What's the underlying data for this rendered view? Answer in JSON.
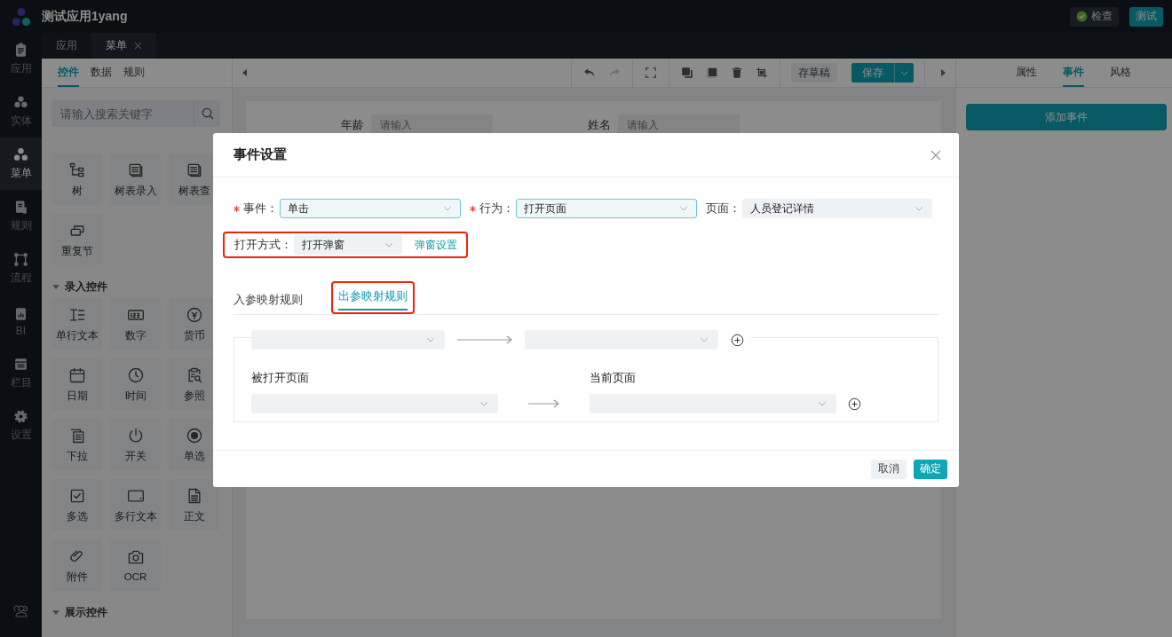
{
  "app": {
    "title": "测试应用1yang",
    "check_button": "检查",
    "test_button": "测试"
  },
  "rail": [
    {
      "label": "应用",
      "kind": "clipboard",
      "selected": false
    },
    {
      "label": "实体",
      "kind": "cubes",
      "selected": false
    },
    {
      "label": "菜单",
      "kind": "dots",
      "selected": true
    },
    {
      "label": "规则",
      "kind": "rules",
      "selected": false
    },
    {
      "label": "流程",
      "kind": "flow",
      "selected": false
    },
    {
      "label": "BI",
      "kind": "chart",
      "selected": false
    },
    {
      "label": "栏目",
      "kind": "columns",
      "selected": false
    },
    {
      "label": "设置",
      "kind": "gear",
      "selected": false
    }
  ],
  "page_tabs": [
    {
      "label": "应用",
      "selected": false,
      "closable": false
    },
    {
      "label": "菜单",
      "selected": true,
      "closable": true
    }
  ],
  "left_panel": {
    "tabs": [
      {
        "label": "控件",
        "selected": true
      },
      {
        "label": "数据",
        "selected": false
      },
      {
        "label": "规则",
        "selected": false
      }
    ],
    "search": {
      "placeholder": "请输入搜索关键字"
    },
    "groups": [
      {
        "items": [
          {
            "label": "树",
            "kind": "tree"
          },
          {
            "label": "树表录入",
            "kind": "table"
          },
          {
            "label": "树表查",
            "kind": "table"
          },
          {
            "label": "重复节",
            "kind": "repeat"
          }
        ]
      },
      {
        "title": "录入控件",
        "items": [
          {
            "label": "单行文本",
            "kind": "text"
          },
          {
            "label": "数字",
            "kind": "number"
          },
          {
            "label": "货币",
            "kind": "currency"
          },
          {
            "label": "日期",
            "kind": "date"
          },
          {
            "label": "时间",
            "kind": "time"
          },
          {
            "label": "参照",
            "kind": "lookup"
          },
          {
            "label": "下拉",
            "kind": "dropdown"
          },
          {
            "label": "开关",
            "kind": "switch"
          },
          {
            "label": "单选",
            "kind": "radio"
          },
          {
            "label": "多选",
            "kind": "checkbox"
          },
          {
            "label": "多行文本",
            "kind": "textarea"
          },
          {
            "label": "正文",
            "kind": "document"
          },
          {
            "label": "附件",
            "kind": "attachment"
          },
          {
            "label": "OCR",
            "kind": "camera"
          }
        ]
      },
      {
        "title": "展示控件"
      }
    ]
  },
  "canvas": {
    "toolbar": {
      "draft_button": "存草稿",
      "save_button": "保存"
    },
    "form_fields": [
      {
        "label": "年龄",
        "placeholder": "请输入"
      },
      {
        "label": "姓名",
        "placeholder": "请输入"
      }
    ]
  },
  "right_panel": {
    "tabs": [
      {
        "label": "属性",
        "selected": false
      },
      {
        "label": "事件",
        "selected": true
      },
      {
        "label": "风格",
        "selected": false
      }
    ],
    "add_button": "添加事件"
  },
  "dialog": {
    "title": "事件设置",
    "fields": [
      {
        "label": "事件：",
        "required": true,
        "value": "单击",
        "focused": true
      },
      {
        "label": "行为：",
        "required": true,
        "value": "打开页面",
        "focused": true
      },
      {
        "label": "页面：",
        "required": false,
        "value": "人员登记详情",
        "focused": false
      }
    ],
    "open_mode": {
      "label": "打开方式：",
      "value": "打开弹窗",
      "link": "弹窗设置",
      "highlighted": true
    },
    "tabs": [
      {
        "label": "入参映射规则",
        "selected": false,
        "highlighted": false
      },
      {
        "label": "出参映射规则",
        "selected": true,
        "highlighted": true
      }
    ],
    "mapping": {
      "source_label": "被打开页面",
      "target_label": "当前页面"
    },
    "cancel_button": "取消",
    "ok_button": "确定"
  }
}
